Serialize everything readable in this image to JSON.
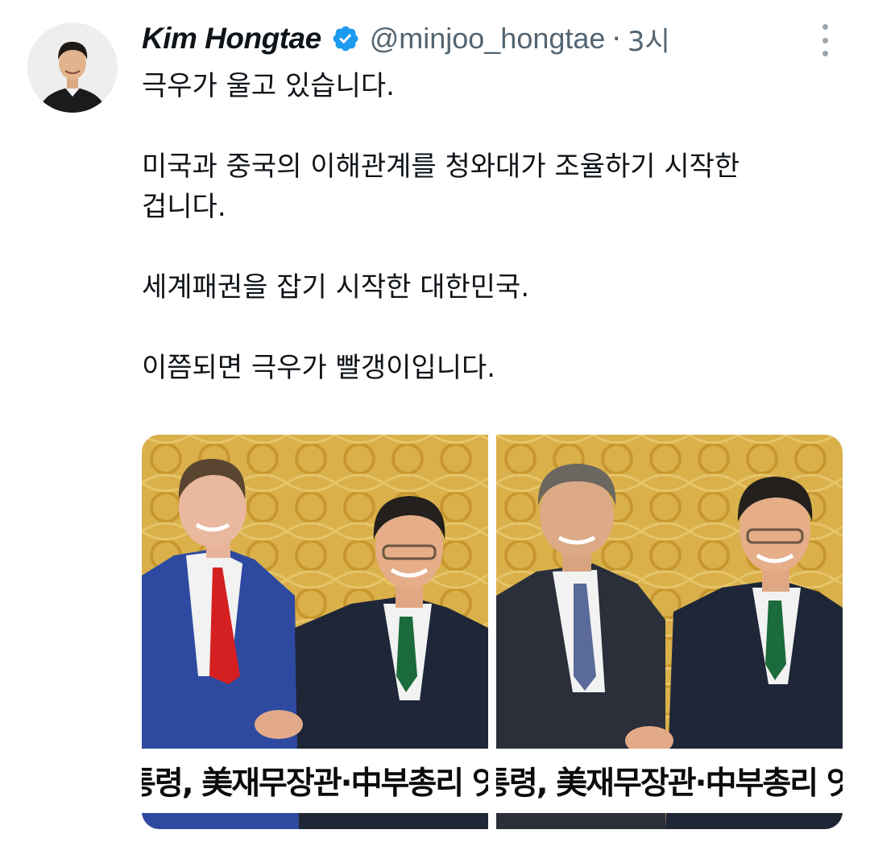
{
  "tweet": {
    "author_name": "Kim Hongtae",
    "handle": "@minjoo_hongtae",
    "separator": "·",
    "time": "3시",
    "verified_icon": "verified-badge-icon",
    "more_icon": "more-vertical-icon",
    "text": {
      "line1": "극우가 울고 있습니다.",
      "line2": "미국과 중국의 이해관계를 청와대가 조율하기 시작한",
      "line3": "겁니다.",
      "line4": "세계패권을 잡기 시작한 대한민국.",
      "line5": "이쯤되면 극우가 빨갱이입니다."
    },
    "media": [
      {
        "caption": "통령, 美재무장관·中부총리 잇따라"
      },
      {
        "caption": "통령, 美재무장관·中부총리 잇따라"
      }
    ]
  },
  "colors": {
    "verified": "#1d9bf0",
    "secondary_text": "#536471",
    "primary_text": "#0f1419"
  }
}
